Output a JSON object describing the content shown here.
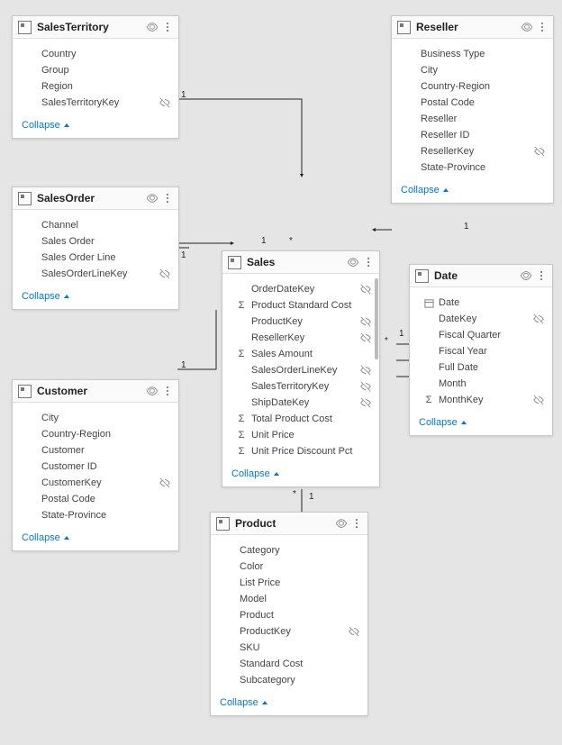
{
  "tables": {
    "SalesTerritory": {
      "title": "SalesTerritory",
      "collapse": "Collapse",
      "fields": [
        {
          "name": "Country",
          "icon": "",
          "hidden": false
        },
        {
          "name": "Group",
          "icon": "",
          "hidden": false
        },
        {
          "name": "Region",
          "icon": "",
          "hidden": false
        },
        {
          "name": "SalesTerritoryKey",
          "icon": "",
          "hidden": true
        }
      ]
    },
    "SalesOrder": {
      "title": "SalesOrder",
      "collapse": "Collapse",
      "fields": [
        {
          "name": "Channel",
          "icon": "",
          "hidden": false
        },
        {
          "name": "Sales Order",
          "icon": "",
          "hidden": false
        },
        {
          "name": "Sales Order Line",
          "icon": "",
          "hidden": false
        },
        {
          "name": "SalesOrderLineKey",
          "icon": "",
          "hidden": true
        }
      ]
    },
    "Customer": {
      "title": "Customer",
      "collapse": "Collapse",
      "fields": [
        {
          "name": "City",
          "icon": "",
          "hidden": false
        },
        {
          "name": "Country-Region",
          "icon": "",
          "hidden": false
        },
        {
          "name": "Customer",
          "icon": "",
          "hidden": false
        },
        {
          "name": "Customer ID",
          "icon": "",
          "hidden": false
        },
        {
          "name": "CustomerKey",
          "icon": "",
          "hidden": true
        },
        {
          "name": "Postal Code",
          "icon": "",
          "hidden": false
        },
        {
          "name": "State-Province",
          "icon": "",
          "hidden": false
        }
      ]
    },
    "Reseller": {
      "title": "Reseller",
      "collapse": "Collapse",
      "fields": [
        {
          "name": "Business Type",
          "icon": "",
          "hidden": false
        },
        {
          "name": "City",
          "icon": "",
          "hidden": false
        },
        {
          "name": "Country-Region",
          "icon": "",
          "hidden": false
        },
        {
          "name": "Postal Code",
          "icon": "",
          "hidden": false
        },
        {
          "name": "Reseller",
          "icon": "",
          "hidden": false
        },
        {
          "name": "Reseller ID",
          "icon": "",
          "hidden": false
        },
        {
          "name": "ResellerKey",
          "icon": "",
          "hidden": true
        },
        {
          "name": "State-Province",
          "icon": "",
          "hidden": false
        }
      ]
    },
    "Sales": {
      "title": "Sales",
      "collapse": "Collapse",
      "fields": [
        {
          "name": "OrderDateKey",
          "icon": "",
          "hidden": true
        },
        {
          "name": "Product Standard Cost",
          "icon": "sum",
          "hidden": false
        },
        {
          "name": "ProductKey",
          "icon": "",
          "hidden": true
        },
        {
          "name": "ResellerKey",
          "icon": "",
          "hidden": true
        },
        {
          "name": "Sales Amount",
          "icon": "sum",
          "hidden": false
        },
        {
          "name": "SalesOrderLineKey",
          "icon": "",
          "hidden": true
        },
        {
          "name": "SalesTerritoryKey",
          "icon": "",
          "hidden": true
        },
        {
          "name": "ShipDateKey",
          "icon": "",
          "hidden": true
        },
        {
          "name": "Total Product Cost",
          "icon": "sum",
          "hidden": false
        },
        {
          "name": "Unit Price",
          "icon": "sum",
          "hidden": false
        },
        {
          "name": "Unit Price Discount Pct",
          "icon": "sum",
          "hidden": false
        }
      ]
    },
    "Date": {
      "title": "Date",
      "collapse": "Collapse",
      "fields": [
        {
          "name": "Date",
          "icon": "date",
          "hidden": false
        },
        {
          "name": "DateKey",
          "icon": "",
          "hidden": true
        },
        {
          "name": "Fiscal Quarter",
          "icon": "",
          "hidden": false
        },
        {
          "name": "Fiscal Year",
          "icon": "",
          "hidden": false
        },
        {
          "name": "Full Date",
          "icon": "",
          "hidden": false
        },
        {
          "name": "Month",
          "icon": "",
          "hidden": false
        },
        {
          "name": "MonthKey",
          "icon": "sum",
          "hidden": true
        }
      ]
    },
    "Product": {
      "title": "Product",
      "collapse": "Collapse",
      "fields": [
        {
          "name": "Category",
          "icon": "",
          "hidden": false
        },
        {
          "name": "Color",
          "icon": "",
          "hidden": false
        },
        {
          "name": "List Price",
          "icon": "",
          "hidden": false
        },
        {
          "name": "Model",
          "icon": "",
          "hidden": false
        },
        {
          "name": "Product",
          "icon": "",
          "hidden": false
        },
        {
          "name": "ProductKey",
          "icon": "",
          "hidden": true
        },
        {
          "name": "SKU",
          "icon": "",
          "hidden": false
        },
        {
          "name": "Standard Cost",
          "icon": "",
          "hidden": false
        },
        {
          "name": "Subcategory",
          "icon": "",
          "hidden": false
        }
      ]
    }
  },
  "cardinality": {
    "one": "1",
    "many": "*"
  }
}
